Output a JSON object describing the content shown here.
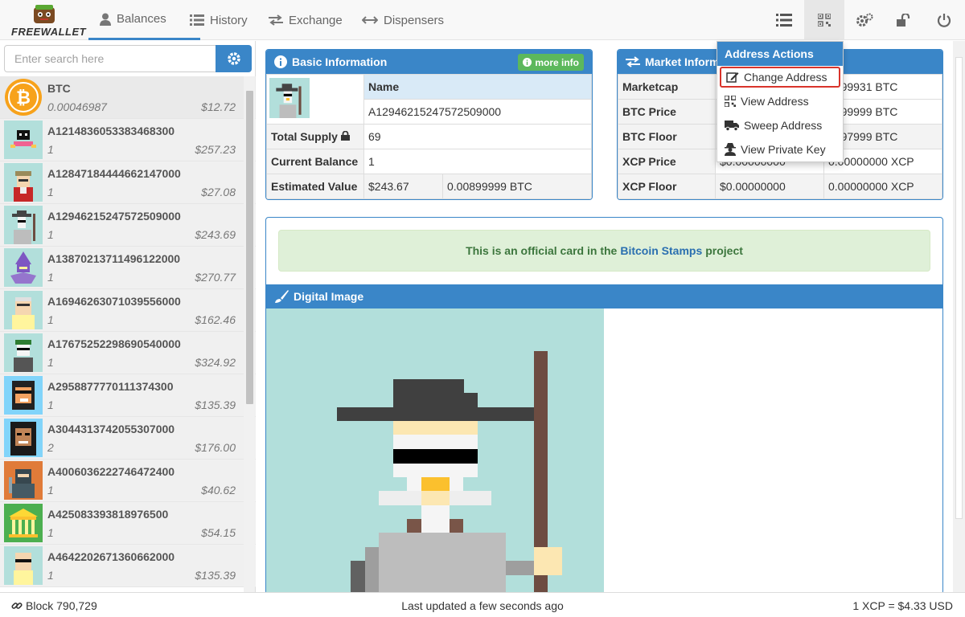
{
  "app": {
    "logo_text": "FREEWALLET"
  },
  "nav": {
    "tabs": [
      {
        "label": "Balances",
        "icon": "user-icon",
        "active": true
      },
      {
        "label": "History",
        "icon": "list-icon"
      },
      {
        "label": "Exchange",
        "icon": "exchange-icon"
      },
      {
        "label": "Dispensers",
        "icon": "arrows-h-icon"
      }
    ],
    "right_icons": [
      "list-icon",
      "qrcode-icon",
      "cogs-icon",
      "unlock-icon",
      "power-icon"
    ]
  },
  "search": {
    "placeholder": "Enter search here"
  },
  "assets": [
    {
      "name": "BTC",
      "qty": "0.00046987",
      "value": "$12.72",
      "icon": "bitcoin-icon"
    },
    {
      "name": "A1214836053383468300",
      "qty": "1",
      "value": "$257.23"
    },
    {
      "name": "A12847184444662147000",
      "qty": "1",
      "value": "$27.08"
    },
    {
      "name": "A12946215247572509000",
      "qty": "1",
      "value": "$243.69"
    },
    {
      "name": "A13870213711496122000",
      "qty": "1",
      "value": "$270.77"
    },
    {
      "name": "A16946263071039556000",
      "qty": "1",
      "value": "$162.46"
    },
    {
      "name": "A17675252298690540000",
      "qty": "1",
      "value": "$324.92"
    },
    {
      "name": "A2958877770111374300",
      "qty": "1",
      "value": "$135.39"
    },
    {
      "name": "A3044313742055307000",
      "qty": "2",
      "value": "$176.00"
    },
    {
      "name": "A4006036222746472400",
      "qty": "1",
      "value": "$40.62"
    },
    {
      "name": "A425083393818976500",
      "qty": "1",
      "value": "$54.15"
    },
    {
      "name": "A4642202671360662000",
      "qty": "1",
      "value": "$135.39"
    }
  ],
  "basic_info": {
    "title": "Basic Information",
    "more_info": "more info",
    "name_label": "Name",
    "name_value": "A12946215247572509000",
    "total_supply_label": "Total Supply",
    "total_supply": "69",
    "current_balance_label": "Current Balance",
    "current_balance": "1",
    "estimated_value_label": "Estimated Value",
    "estimated_usd": "$243.67",
    "estimated_btc": "0.00899999 BTC"
  },
  "market_info": {
    "title": "Market Inform",
    "rows": [
      {
        "label": "Marketcap",
        "usd": "",
        "btc": "2099931 BTC"
      },
      {
        "label": "BTC Price",
        "usd": "",
        "btc": "0899999 BTC"
      },
      {
        "label": "BTC Floor",
        "usd": "",
        "btc": "0997999 BTC"
      },
      {
        "label": "XCP Price",
        "usd": "$0.00000000",
        "btc": "0.00000000 XCP"
      },
      {
        "label": "XCP Floor",
        "usd": "$0.00000000",
        "btc": "0.00000000 XCP"
      }
    ]
  },
  "address_actions": {
    "title": "Address Actions",
    "items": [
      {
        "label": "Change Address",
        "icon": "edit-icon",
        "highlighted": true
      },
      {
        "label": "View Address",
        "icon": "qrcode-icon"
      },
      {
        "label": "Sweep Address",
        "icon": "truck-icon"
      },
      {
        "label": "View Private Key",
        "icon": "user-secret-icon"
      }
    ]
  },
  "notice": {
    "prefix": "This is an official card in the",
    "link": "Bitcoin Stamps",
    "suffix": "project"
  },
  "digital_image": {
    "title": "Digital Image"
  },
  "footer": {
    "block": "Block 790,729",
    "updated": "Last updated a few seconds ago",
    "rate": "1 XCP = $4.33 USD"
  },
  "colors": {
    "accent": "#3a86c8",
    "success": "#5cb85c",
    "highlight": "#d9342b"
  }
}
